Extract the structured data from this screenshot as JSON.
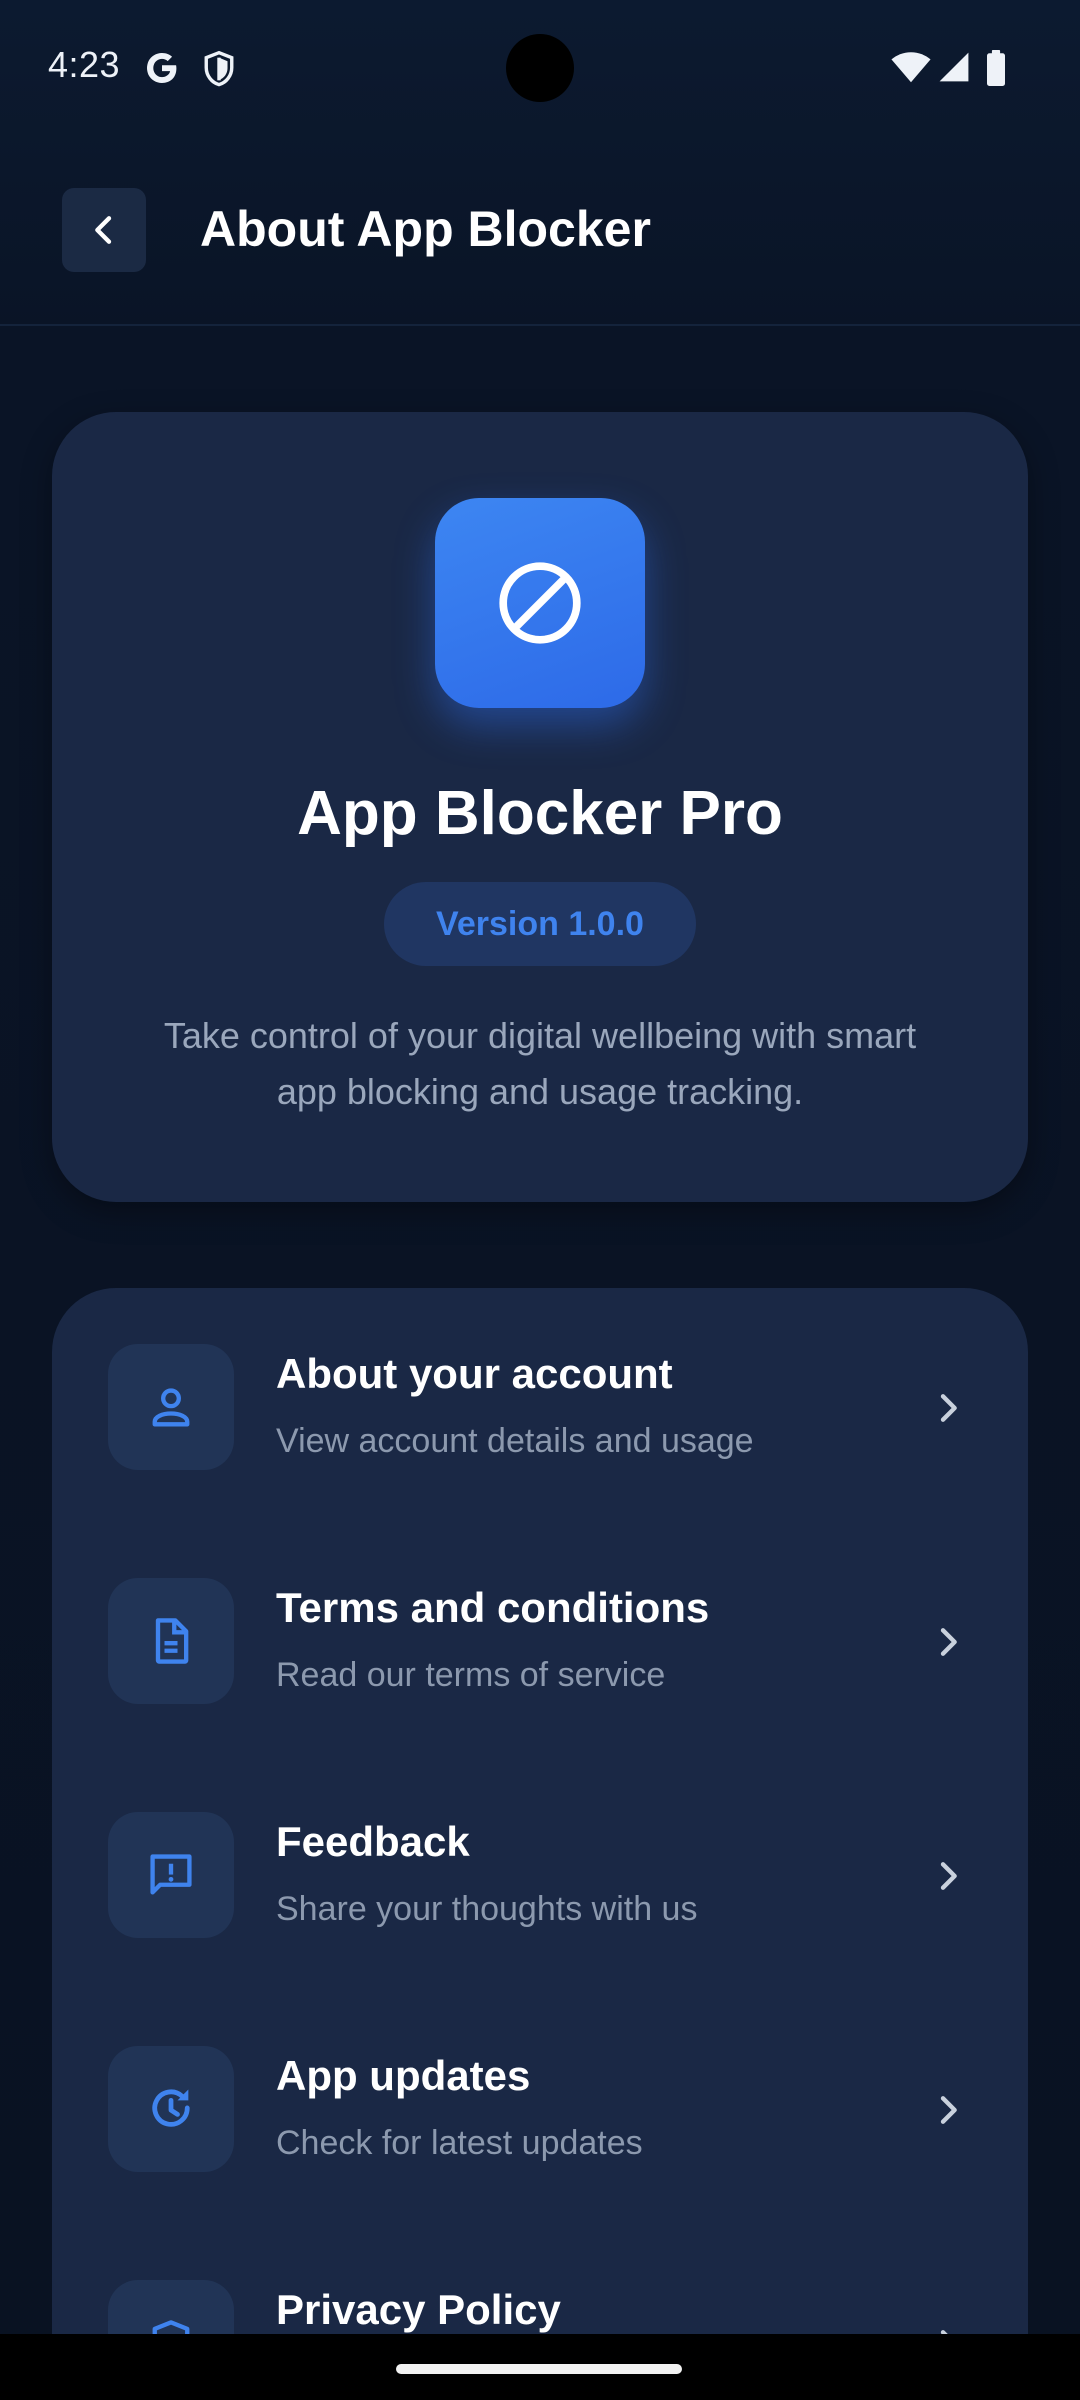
{
  "status_bar": {
    "time": "4:23",
    "icons": [
      "google-icon",
      "shield-icon",
      "wifi-icon",
      "signal-icon",
      "battery-icon"
    ]
  },
  "header": {
    "title": "About App Blocker",
    "back_icon": "chevron-left-icon"
  },
  "hero": {
    "app_icon": "block-icon",
    "app_name": "App Blocker Pro",
    "version": "Version 1.0.0",
    "description": "Take control of your digital wellbeing with smart app blocking and usage tracking."
  },
  "menu": {
    "items": [
      {
        "title": "About your account",
        "subtitle": "View account details and usage",
        "icon": "person-icon"
      },
      {
        "title": "Terms and conditions",
        "subtitle": "Read our terms of service",
        "icon": "document-icon"
      },
      {
        "title": "Feedback",
        "subtitle": "Share your thoughts with us",
        "icon": "feedback-icon"
      },
      {
        "title": "App updates",
        "subtitle": "Check for latest updates",
        "icon": "update-icon"
      },
      {
        "title": "Privacy Policy",
        "subtitle": "",
        "icon": "privacy-icon"
      }
    ]
  },
  "colors": {
    "background": "#0a1426",
    "card": "#1a2845",
    "accent": "#3f83ee",
    "icon_tile": "#213456",
    "secondary_text": "#8c99ae"
  }
}
